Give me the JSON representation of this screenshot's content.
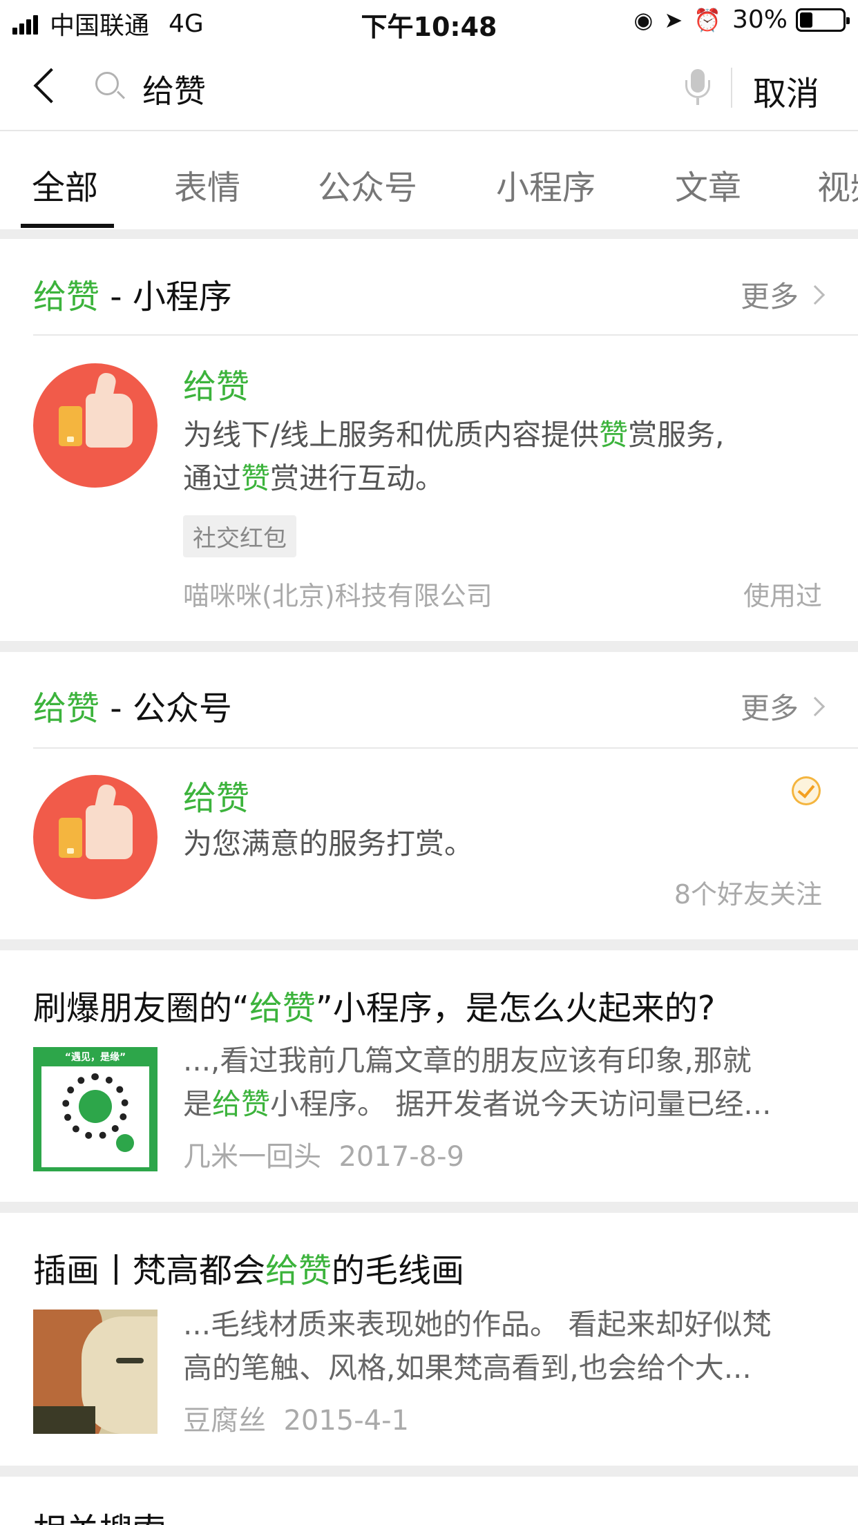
{
  "status_bar": {
    "carrier": "中国联通",
    "network": "4G",
    "time": "下午10:48",
    "battery": "30%",
    "battery_level": 0.3,
    "icons": [
      "orientation-lock-icon",
      "location-arrow-icon",
      "alarm-icon"
    ]
  },
  "search": {
    "query": "给赞",
    "cancel_label": "取消"
  },
  "tabs": [
    "全部",
    "表情",
    "公众号",
    "小程序",
    "文章",
    "视频"
  ],
  "active_tab": 0,
  "miniprogram_section": {
    "keyword": "给赞",
    "suffix": " - 小程序",
    "more_label": "更多",
    "item": {
      "title": "给赞",
      "desc_line1_a": "为线下/线上服务和优质内容提供",
      "desc_line1_hl": "赞",
      "desc_line1_b": "赏服务,",
      "desc_line2_a": "通过",
      "desc_line2_hl": "赞",
      "desc_line2_b": "赏进行互动。",
      "tag": "社交红包",
      "company": "喵咪咪(北京)科技有限公司",
      "used": "使用过"
    }
  },
  "official_section": {
    "keyword": "给赞",
    "suffix": " - 公众号",
    "more_label": "更多",
    "item": {
      "title": "给赞",
      "desc": "为您满意的服务打赏。",
      "friends": "8个好友关注"
    }
  },
  "articles": [
    {
      "title_a": "刷爆朋友圈的“",
      "title_hl": "给赞",
      "title_b": "”小程序，是怎么火起来的?",
      "line1": "...,看过我前几篇文章的朋友应该有印象,那就",
      "line2_a": "是",
      "line2_hl": "给赞",
      "line2_b": "小程序。 据开发者说今天访问量已经...",
      "author": "几米一回头",
      "date": "2017-8-9",
      "thumb_caption": "“遇见，是缘”"
    },
    {
      "title_a": "插画丨梵高都会",
      "title_hl": "给赞",
      "title_b": "的毛线画",
      "line1": "...毛线材质来表现她的作品。 看起来却好似梵",
      "line2_a": "高的笔触、风格,如果梵高看到,也会给个大...",
      "author": "豆腐丝",
      "date": "2015-4-1"
    }
  ],
  "related_label": "相关搜索",
  "colors": {
    "highlight": "#3cb33c",
    "icon_bg": "#f15b4a",
    "separator": "#ededed"
  }
}
